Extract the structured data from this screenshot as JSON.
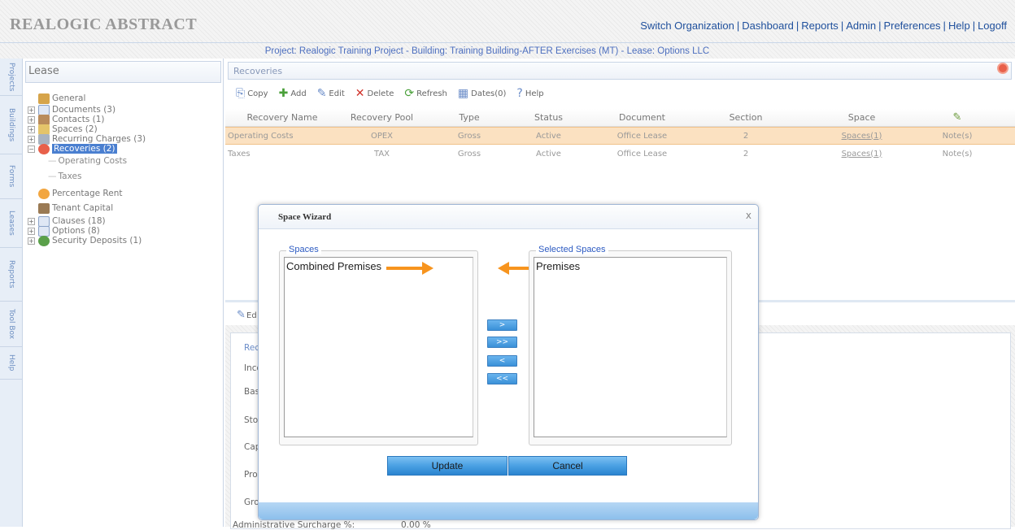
{
  "app": {
    "logo": "REALOGIC ABSTRACT"
  },
  "top_links": [
    "Switch Organization",
    "Dashboard",
    "Reports",
    "Admin",
    "Preferences",
    "Help",
    "Logoff"
  ],
  "project_bar": "Project: Realogic Training Project  -  Building: Training Building-AFTER Exercises (MT)  -  Lease: Options LLC",
  "side_tabs": [
    "Projects",
    "Buildings",
    "Forms",
    "Leases",
    "Reports",
    "Tool Box",
    "Help"
  ],
  "left_panel": {
    "title": "Lease",
    "tree": [
      {
        "label": "General",
        "icon": "folder-icon"
      },
      {
        "label": "Documents (3)",
        "icon": "document-icon"
      },
      {
        "label": "Contacts (1)",
        "icon": "contacts-icon"
      },
      {
        "label": "Spaces (2)",
        "icon": "spaces-icon"
      },
      {
        "label": "Recurring Charges (3)",
        "icon": "recurring-charges-icon"
      },
      {
        "label": "Recoveries (2)",
        "icon": "recoveries-icon"
      },
      {
        "label": "Operating Costs"
      },
      {
        "label": "Taxes"
      },
      {
        "label": "Percentage Rent",
        "icon": "pie-icon"
      },
      {
        "label": "Tenant Capital",
        "icon": "tool-icon"
      },
      {
        "label": "Clauses (18)",
        "icon": "clauses-icon"
      },
      {
        "label": "Options (8)",
        "icon": "options-icon"
      },
      {
        "label": "Security Deposits (1)",
        "icon": "deposit-icon"
      }
    ]
  },
  "recoveries": {
    "title": "Recoveries",
    "toolbar": [
      "Copy",
      "Add",
      "Edit",
      "Delete",
      "Refresh",
      "Dates(0)",
      "Help"
    ],
    "columns": [
      "Recovery Name",
      "Recovery Pool",
      "Type",
      "Status",
      "Document",
      "Section",
      "Space",
      ""
    ],
    "rows": [
      [
        "Operating Costs",
        "OPEX",
        "Gross",
        "Active",
        "Office Lease",
        "2",
        "Spaces(1)",
        "Note(s)"
      ],
      [
        "Taxes",
        "TAX",
        "Gross",
        "Active",
        "Office Lease",
        "2",
        "Spaces(1)",
        "Note(s)"
      ]
    ]
  },
  "detail": {
    "edit_label": "Ed",
    "tab_label": "Rec",
    "fields": [
      "Incor",
      "Base",
      "Stop",
      "Cap:",
      "Pro-r",
      "Gros",
      "Administrative Surcharge %:"
    ],
    "surcharge_value": "0.00 %"
  },
  "wizard": {
    "title": "Space Wizard",
    "close": "x",
    "spaces_legend": "Spaces",
    "selected_legend": "Selected Spaces",
    "spaces": [
      "Combined Premises"
    ],
    "selected": [
      "Premises"
    ],
    "move_buttons": [
      ">",
      ">>",
      "<",
      "<<"
    ],
    "update_label": "Update",
    "cancel_label": "Cancel"
  },
  "colors": {
    "link": "#1e4f9c",
    "selected_row": "#fbe1c1",
    "arrow": "#f7941e",
    "button": "#4aa0e3"
  }
}
